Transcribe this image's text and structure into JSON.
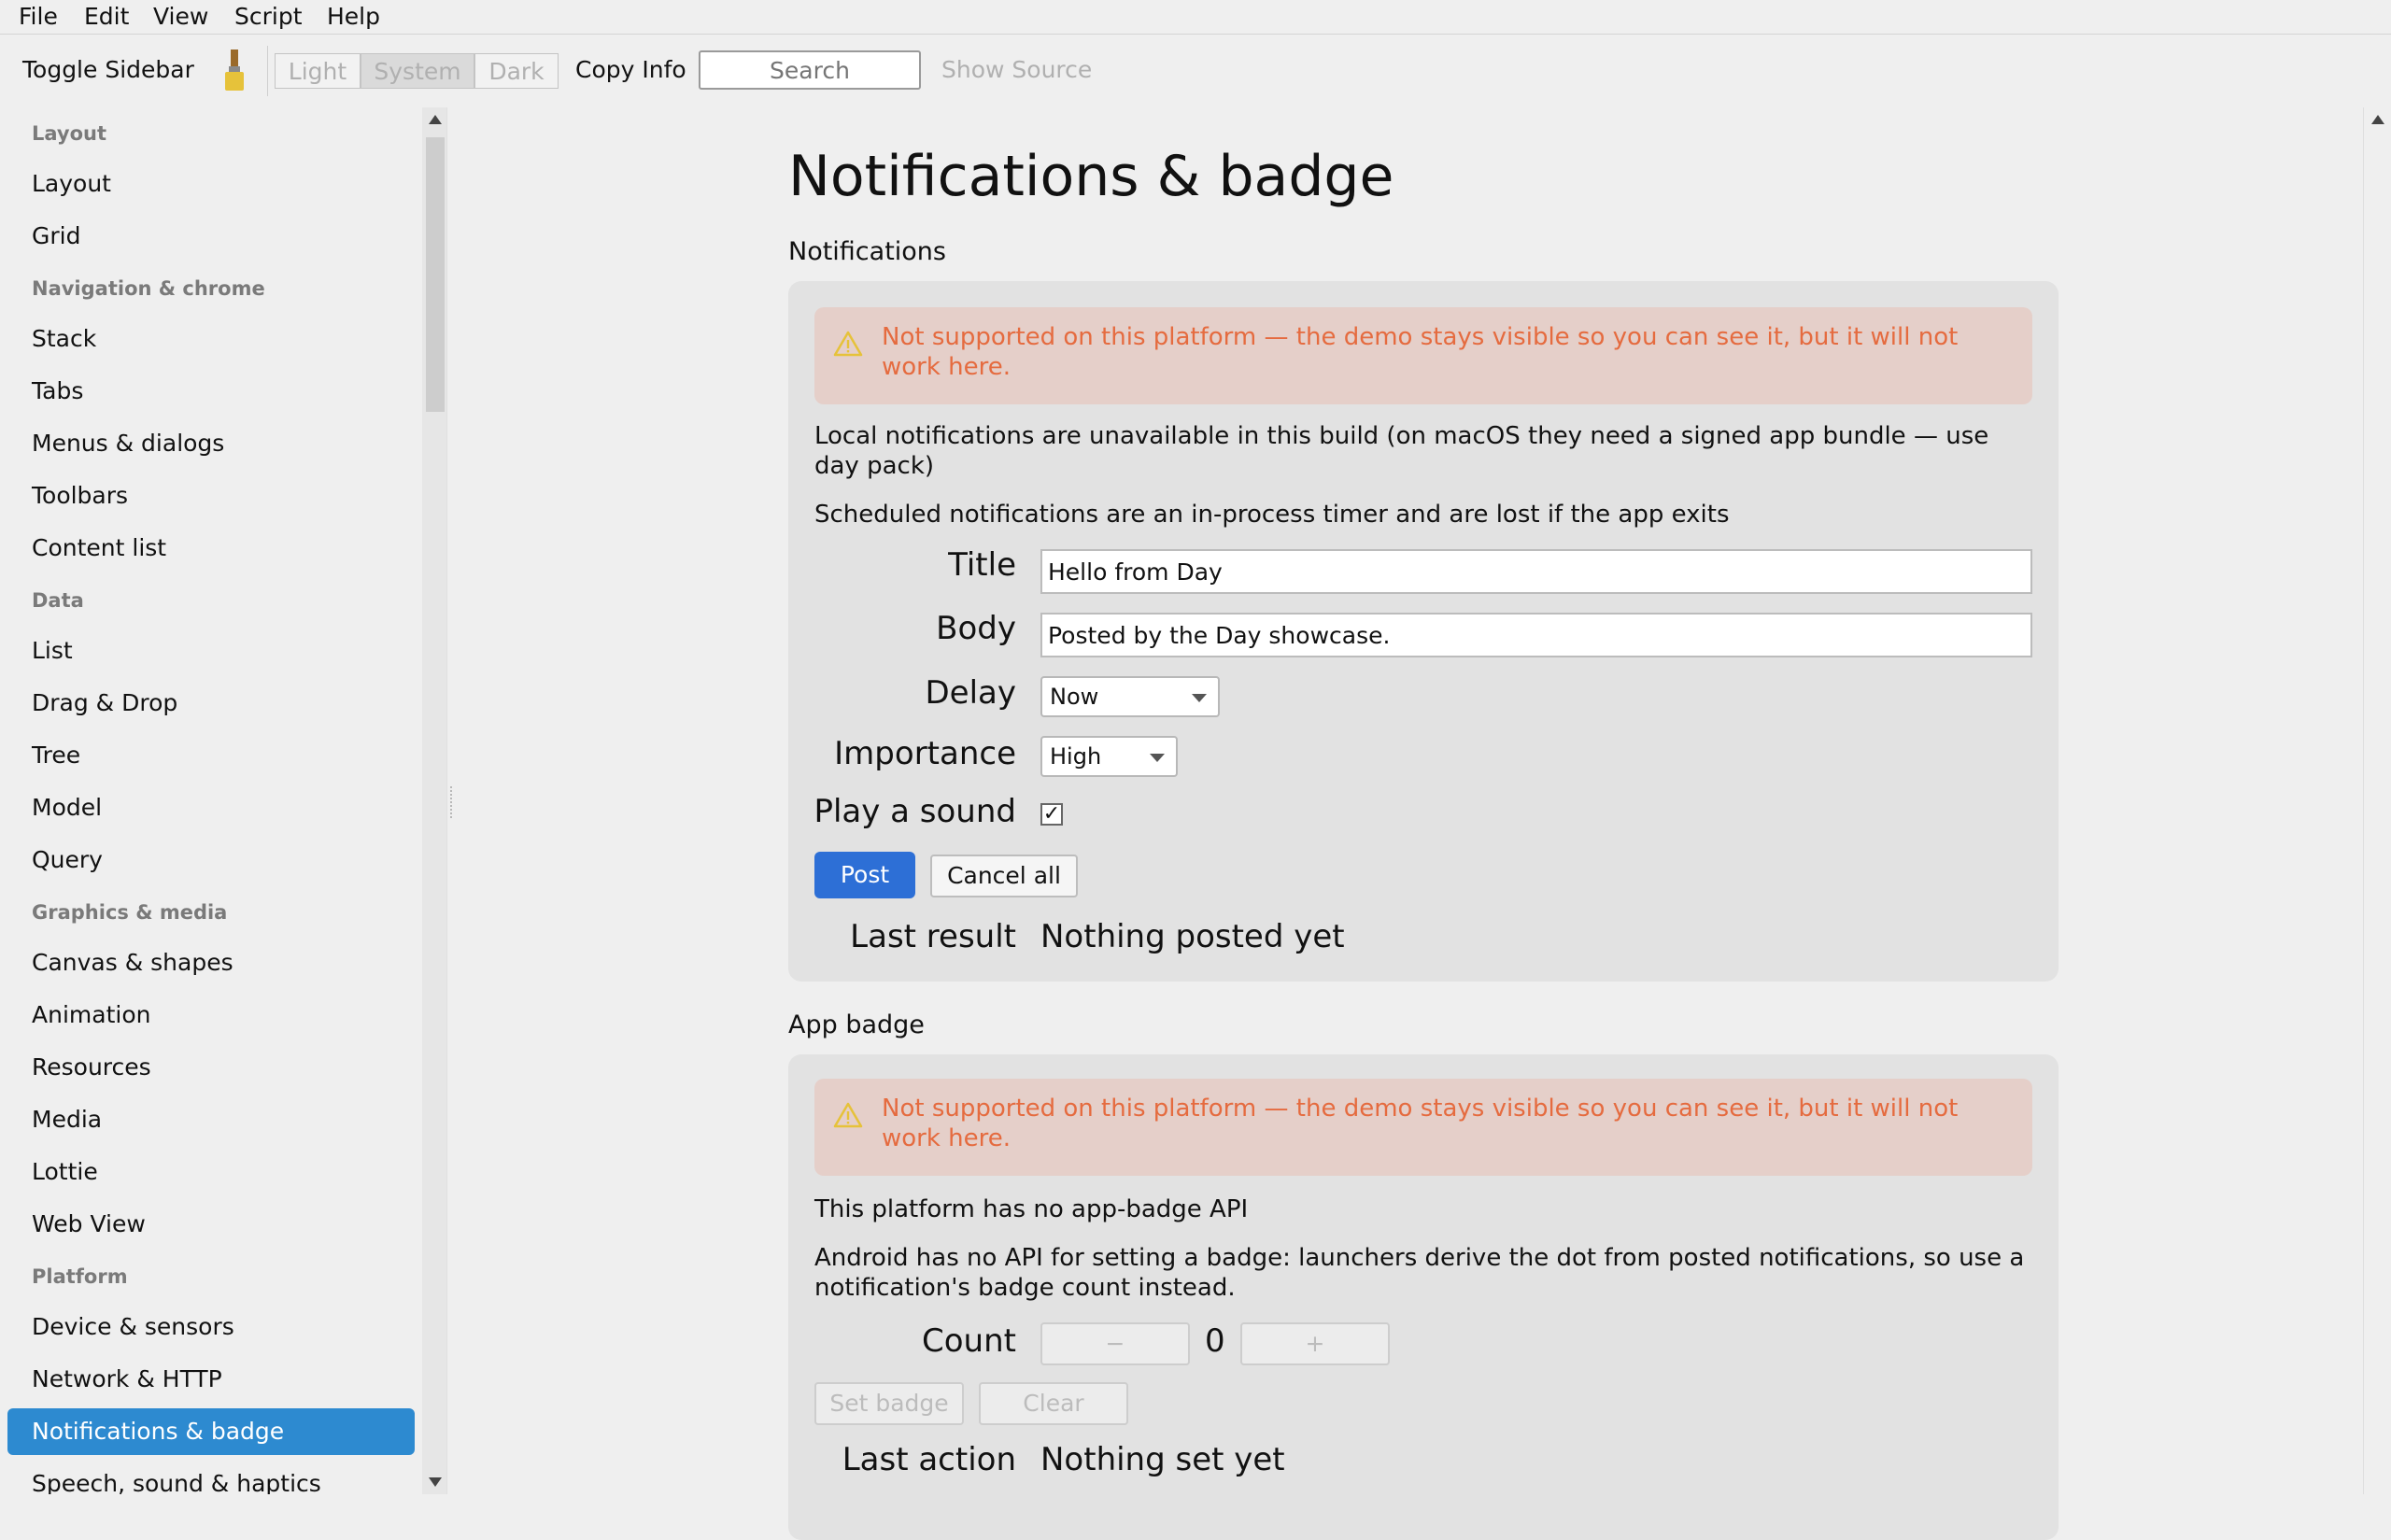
{
  "menu": [
    "File",
    "Edit",
    "View",
    "Script",
    "Help"
  ],
  "toolbar": {
    "toggle_sidebar": "Toggle Sidebar",
    "theme": [
      "Light",
      "System",
      "Dark"
    ],
    "copy_info": "Copy Info",
    "search_placeholder": "Search",
    "show_source": "Show Source"
  },
  "sidebar": {
    "h_layout": "Layout",
    "i_layout": "Layout",
    "i_grid": "Grid",
    "h_nav": "Navigation & chrome",
    "i_stack": "Stack",
    "i_tabs": "Tabs",
    "i_menus": "Menus & dialogs",
    "i_toolbars": "Toolbars",
    "i_content_list": "Content list",
    "h_data": "Data",
    "i_list": "List",
    "i_drag": "Drag & Drop",
    "i_tree": "Tree",
    "i_model": "Model",
    "i_query": "Query",
    "h_graphics": "Graphics & media",
    "i_canvas": "Canvas & shapes",
    "i_animation": "Animation",
    "i_resources": "Resources",
    "i_media": "Media",
    "i_lottie": "Lottie",
    "i_webview": "Web View",
    "h_platform": "Platform",
    "i_device": "Device & sensors",
    "i_network": "Network & HTTP",
    "i_notifications": "Notifications & badge",
    "i_speech": "Speech, sound & haptics"
  },
  "page": {
    "title": "Notifications & badge",
    "notifications": {
      "section_title": "Notifications",
      "warning": "Not supported on this platform — the demo stays visible so you can see it, but it will not work here.",
      "info1": "Local notifications are unavailable in this build (on macOS they need a signed app bundle — use day pack)",
      "info2": "Scheduled notifications are an in-process timer and are lost if the app exits",
      "title_label": "Title",
      "title_value": "Hello from Day",
      "body_label": "Body",
      "body_value": "Posted by the Day showcase.",
      "delay_label": "Delay",
      "delay_value": "Now",
      "importance_label": "Importance",
      "importance_value": "High",
      "sound_label": "Play a sound",
      "sound_check": "✓",
      "post_button": "Post",
      "cancel_button": "Cancel all",
      "last_result_label": "Last result",
      "last_result_value": "Nothing posted yet"
    },
    "badge": {
      "section_title": "App badge",
      "warning": "Not supported on this platform — the demo stays visible so you can see it, but it will not work here.",
      "info1": "This platform has no app-badge API",
      "info2": "Android has no API for setting a badge: launchers derive the dot from posted notifications, so use a notification's badge count instead.",
      "count_label": "Count",
      "minus": "−",
      "count_value": "0",
      "plus": "+",
      "set_button": "Set badge",
      "clear_button": "Clear",
      "last_action_label": "Last action",
      "last_action_value": "Nothing set yet"
    }
  },
  "colors": {
    "accent": "#2d8ad0",
    "primary_button": "#2d6fd6",
    "warning_text": "#e56b3f",
    "warning_bg": "#e5cfc9",
    "warning_icon": "#e6c23a"
  }
}
